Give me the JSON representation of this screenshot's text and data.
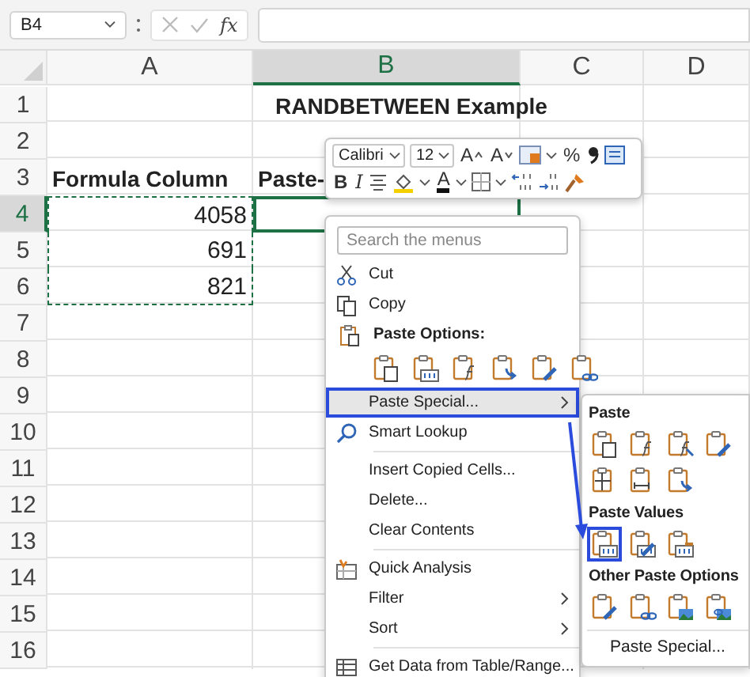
{
  "formula_bar": {
    "name_box": "B4",
    "function_label": "fx"
  },
  "sheet": {
    "columns": [
      {
        "label": "A",
        "selected": false
      },
      {
        "label": "B",
        "selected": true
      },
      {
        "label": "C",
        "selected": false
      },
      {
        "label": "D",
        "selected": false
      }
    ],
    "rows": [
      {
        "label": "1",
        "selected": false,
        "kind": "title",
        "b": "RANDBETWEEN Example",
        "copied": false,
        "active": false
      },
      {
        "label": "2",
        "selected": false,
        "kind": "empty",
        "copied": false,
        "active": false
      },
      {
        "label": "3",
        "selected": false,
        "kind": "header",
        "a": "Formula Column",
        "b": "Paste-",
        "copied": false,
        "active": false
      },
      {
        "label": "4",
        "selected": true,
        "kind": "number",
        "a": "4058",
        "copied": true,
        "active": true
      },
      {
        "label": "5",
        "selected": false,
        "kind": "number",
        "a": "691",
        "copied": true,
        "active": false
      },
      {
        "label": "6",
        "selected": false,
        "kind": "number",
        "a": "821",
        "copied": true,
        "active": false
      },
      {
        "label": "7",
        "selected": false,
        "kind": "empty",
        "copied": false,
        "active": false
      },
      {
        "label": "8",
        "selected": false,
        "kind": "empty",
        "copied": false,
        "active": false
      },
      {
        "label": "9",
        "selected": false,
        "kind": "empty",
        "copied": false,
        "active": false
      },
      {
        "label": "10",
        "selected": false,
        "kind": "empty",
        "copied": false,
        "active": false
      },
      {
        "label": "11",
        "selected": false,
        "kind": "empty",
        "copied": false,
        "active": false
      },
      {
        "label": "12",
        "selected": false,
        "kind": "empty",
        "copied": false,
        "active": false
      },
      {
        "label": "13",
        "selected": false,
        "kind": "empty",
        "copied": false,
        "active": false
      },
      {
        "label": "14",
        "selected": false,
        "kind": "empty",
        "copied": false,
        "active": false
      },
      {
        "label": "15",
        "selected": false,
        "kind": "empty",
        "copied": false,
        "active": false
      },
      {
        "label": "16",
        "selected": false,
        "kind": "empty",
        "copied": false,
        "active": false
      }
    ]
  },
  "mini_toolbar": {
    "font": "Calibri",
    "size": "12",
    "grow_font": "A",
    "shrink_font": "A",
    "percent": "%",
    "bold": "B",
    "italic": "I",
    "font_color": "A"
  },
  "context_menu": {
    "search_placeholder": "Search the menus",
    "items": [
      {
        "kind": "cut",
        "label": "Cut",
        "selected": false,
        "submenu": false
      },
      {
        "kind": "copy",
        "label": "Copy",
        "selected": false,
        "submenu": false
      },
      {
        "kind": "header",
        "label": "Paste Options:"
      },
      {
        "kind": "paste_icons",
        "icons": [
          {
            "kind": "paste"
          },
          {
            "kind": "values"
          },
          {
            "kind": "formulas"
          },
          {
            "kind": "transpose"
          },
          {
            "kind": "formatting"
          },
          {
            "kind": "link"
          }
        ]
      },
      {
        "kind": "plain",
        "label": "Paste Special...",
        "selected": true,
        "submenu": true
      },
      {
        "kind": "lookup",
        "label": "Smart Lookup",
        "selected": false,
        "submenu": false
      },
      {
        "kind": "separator"
      },
      {
        "kind": "plain",
        "label": "Insert Copied Cells...",
        "selected": false,
        "submenu": false
      },
      {
        "kind": "plain",
        "label": "Delete...",
        "selected": false,
        "submenu": false
      },
      {
        "kind": "plain",
        "label": "Clear Contents",
        "selected": false,
        "submenu": false
      },
      {
        "kind": "separator"
      },
      {
        "kind": "analysis",
        "label": "Quick Analysis",
        "selected": false,
        "submenu": false
      },
      {
        "kind": "plain",
        "label": "Filter",
        "selected": false,
        "submenu": true
      },
      {
        "kind": "plain",
        "label": "Sort",
        "selected": false,
        "submenu": true
      },
      {
        "kind": "separator"
      },
      {
        "kind": "table",
        "label": "Get Data from Table/Range...",
        "selected": false,
        "submenu": false
      }
    ]
  },
  "paste_submenu": {
    "sections": [
      {
        "title": "Paste",
        "icons": [
          {
            "kind": "paste",
            "selected": false
          },
          {
            "kind": "formulas",
            "selected": false
          },
          {
            "kind": "formulas_format",
            "selected": false
          },
          {
            "kind": "keep_format",
            "selected": false
          },
          {
            "kind": "no_borders",
            "selected": false
          },
          {
            "kind": "column_widths",
            "selected": false
          },
          {
            "kind": "transpose",
            "selected": false
          }
        ]
      },
      {
        "title": "Paste Values",
        "icons": [
          {
            "kind": "values",
            "selected": true
          },
          {
            "kind": "values_format",
            "selected": false
          },
          {
            "kind": "values_source",
            "selected": false
          }
        ]
      },
      {
        "title": "Other Paste Options",
        "icons": [
          {
            "kind": "formatting",
            "selected": false
          },
          {
            "kind": "link",
            "selected": false
          },
          {
            "kind": "picture",
            "selected": false
          },
          {
            "kind": "linked_picture",
            "selected": false
          }
        ]
      }
    ],
    "footer": "Paste Special..."
  }
}
